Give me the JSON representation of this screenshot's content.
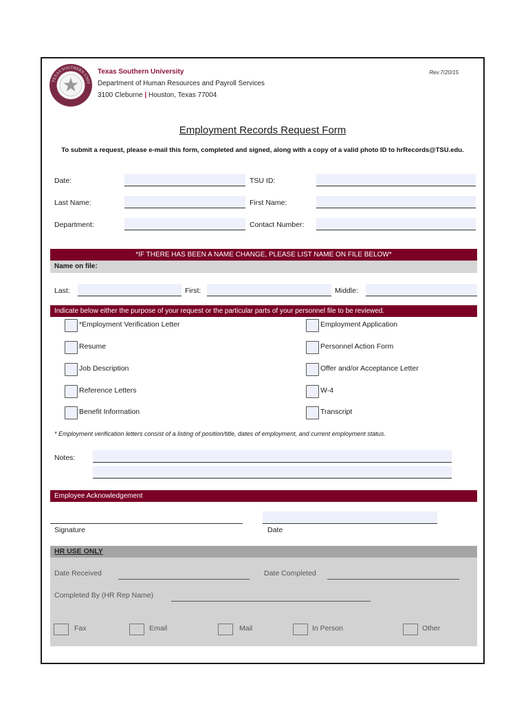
{
  "header": {
    "org_name": "Texas Southern University",
    "department": "Department of Human Resources and Payroll Services",
    "address_street": "3100 Cleburne",
    "address_separator": "|",
    "address_city": "Houston, Texas 77004",
    "revision": "Rev.7/20/15",
    "seal_icon": "university-seal-icon"
  },
  "form": {
    "title": "Employment Records Request Form",
    "instructions": "To submit a request, please e-mail this form, completed and signed, along with a copy of a valid photo ID to hrRecords@TSU.edu."
  },
  "fields": {
    "date": {
      "label": "Date:",
      "value": ""
    },
    "tsu_id": {
      "label": "TSU ID:",
      "value": ""
    },
    "last_name": {
      "label": "Last Name:",
      "value": ""
    },
    "first_name": {
      "label": "First Name:",
      "value": ""
    },
    "department": {
      "label": "Department:",
      "value": ""
    },
    "contact_number": {
      "label": "Contact Number:",
      "value": ""
    }
  },
  "name_change": {
    "banner": "*IF THERE HAS BEEN A NAME CHANGE, PLEASE LIST NAME ON FILE BELOW*",
    "subheader": "Name on file:",
    "last": {
      "label": "Last:",
      "value": ""
    },
    "first": {
      "label": "First:",
      "value": ""
    },
    "middle": {
      "label": "Middle:",
      "value": ""
    }
  },
  "purpose": {
    "banner": "Indicate below either the purpose of your request or the particular parts of your personnel file to be reviewed.",
    "left_options": [
      {
        "label": "*Employment Verification Letter",
        "checked": false
      },
      {
        "label": "Resume",
        "checked": false
      },
      {
        "label": "Job Description",
        "checked": false
      },
      {
        "label": "Reference Letters",
        "checked": false
      },
      {
        "label": "Benefit Information",
        "checked": false
      }
    ],
    "right_options": [
      {
        "label": "Employment Application",
        "checked": false
      },
      {
        "label": "Personnel Action Form",
        "checked": false
      },
      {
        "label": "Offer and/or Acceptance Letter",
        "checked": false
      },
      {
        "label": "W-4",
        "checked": false
      },
      {
        "label": "Transcript",
        "checked": false
      }
    ],
    "footnote": "* Employment verification letters consist of a listing of position/title, dates of employment, and current employment status."
  },
  "notes": {
    "label": "Notes:",
    "line1": "",
    "line2": ""
  },
  "acknowledgement": {
    "banner": "Employee Acknowledgement",
    "signature_label": "Signature",
    "date_label": "Date"
  },
  "hr_use": {
    "header": "HR USE ONLY",
    "date_received": "Date Received",
    "date_completed": "Date Completed",
    "completed_by": "Completed By (HR Rep Name)",
    "methods": [
      "Fax",
      "Email",
      "Mail",
      "In Person",
      "Other"
    ]
  },
  "colors": {
    "brand_maroon": "#7a0026",
    "field_fill": "#eef0fb",
    "hr_panel": "#d3d2d3",
    "hr_header": "#a7a4a5"
  }
}
